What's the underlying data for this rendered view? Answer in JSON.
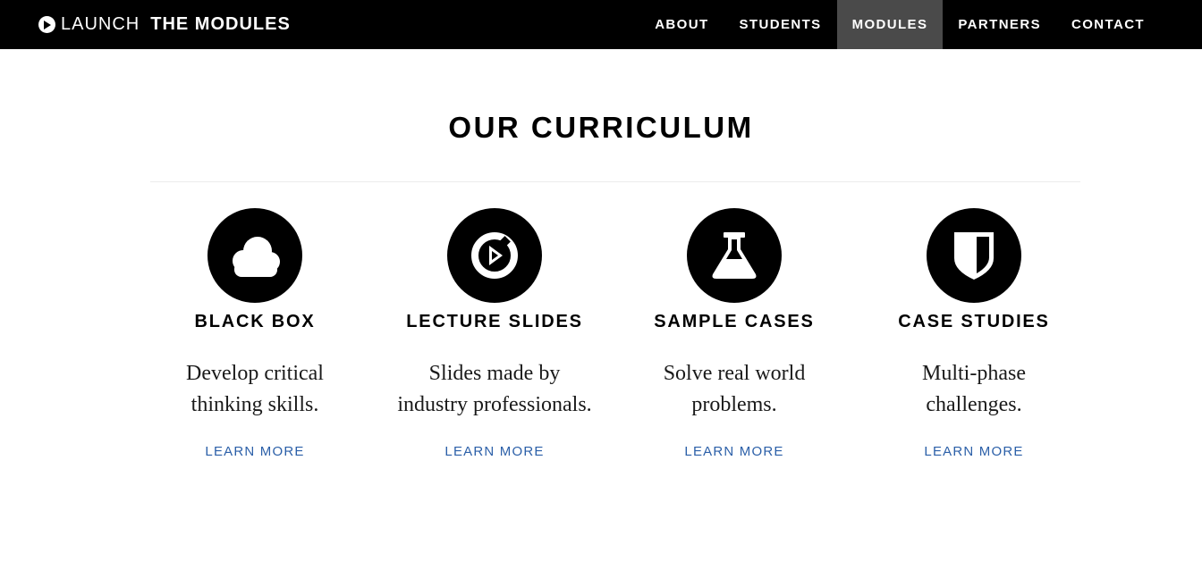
{
  "header": {
    "brand_light": "LAUNCH",
    "brand_bold": "THE MODULES",
    "brand_icon": "play-circle-icon",
    "background": "#000000",
    "nav": [
      {
        "label": "ABOUT",
        "active": false
      },
      {
        "label": "STUDENTS",
        "active": false
      },
      {
        "label": "MODULES",
        "active": true
      },
      {
        "label": "PARTNERS",
        "active": false
      },
      {
        "label": "CONTACT",
        "active": false
      }
    ],
    "active_nav_color": "#4a4a4a"
  },
  "main": {
    "heading": "OUR CURRICULUM",
    "link_color": "#2b5fa8",
    "cards": [
      {
        "icon": "cloud-icon",
        "title": "BLACK BOX",
        "desc_line1": "Develop critical",
        "desc_line2": "thinking skills.",
        "link": "LEARN MORE"
      },
      {
        "icon": "presentation-icon",
        "title": "LECTURE SLIDES",
        "desc_line1": "Slides made by",
        "desc_line2": "industry professionals.",
        "link": "LEARN MORE"
      },
      {
        "icon": "flask-icon",
        "title": "SAMPLE CASES",
        "desc_line1": "Solve real world",
        "desc_line2": "problems.",
        "link": "LEARN MORE"
      },
      {
        "icon": "shield-icon",
        "title": "CASE STUDIES",
        "desc_line1": "Multi-phase",
        "desc_line2": "challenges.",
        "link": "LEARN MORE"
      }
    ]
  }
}
